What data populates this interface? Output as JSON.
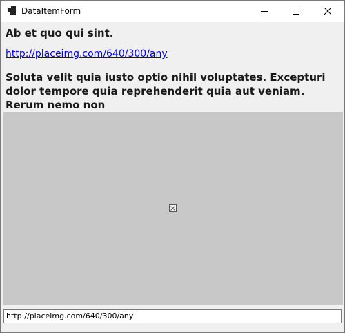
{
  "window": {
    "title": "DataItemForm"
  },
  "icons": {
    "app": "app-icon",
    "minimize": "minimize-icon",
    "maximize": "maximize-icon",
    "close": "close-icon",
    "broken_image": "broken-image-icon"
  },
  "content": {
    "heading": "Ab et quo qui sint.",
    "link_text": "http://placeimg.com/640/300/any",
    "paragraph": "Soluta velit quia iusto optio nihil voluptates. Excepturi dolor tempore quia reprehenderit quia aut veniam. Rerum nemo non",
    "url_field_value": "http://placeimg.com/640/300/any"
  },
  "colors": {
    "link": "#0000ee",
    "form_background": "#f0f0f0",
    "image_placeholder": "#c8c8c8"
  }
}
